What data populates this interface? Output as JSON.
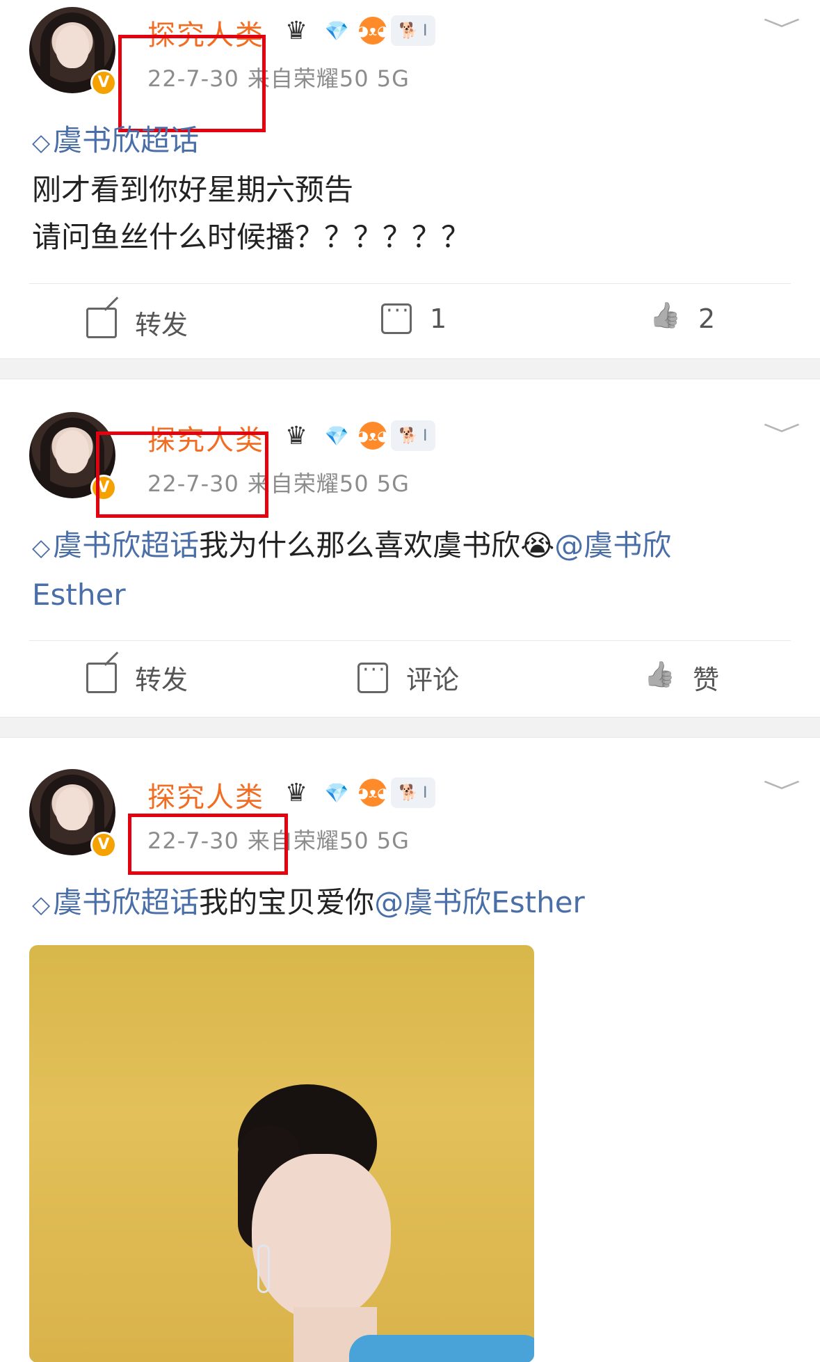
{
  "posts": [
    {
      "username": "探究人类",
      "date": "22-7-30",
      "source": "来自荣耀50 5G",
      "verified_badge": "V",
      "topic": "虞书欣超话",
      "text_lines": [
        "刚才看到你好星期六预告",
        "请问鱼丝什么时候播？？？？？？"
      ],
      "actions": {
        "repost": "转发",
        "comment": "1",
        "like": "2"
      }
    },
    {
      "username": "探究人类",
      "date": "22-7-30",
      "source": "来自荣耀50 5G",
      "verified_badge": "V",
      "topic": "虞书欣超话",
      "text": "我为什么那么喜欢虞书欣",
      "emoji": "😭",
      "mention_a": "@虞书欣",
      "mention_b": "Esther",
      "actions": {
        "repost": "转发",
        "comment": "评论",
        "like": "赞"
      }
    },
    {
      "username": "探究人类",
      "date": "22-7-30",
      "source": "来自荣耀50 5G",
      "verified_badge": "V",
      "topic": "虞书欣超话",
      "text": "我的宝贝爱你",
      "mention": "@虞书欣Esther"
    }
  ],
  "icons": {
    "crown": "♛",
    "gem": "💎",
    "fox": "◕ᴥ◕",
    "dog": "🐕 I",
    "topic": "◇",
    "chevron": "﹀"
  },
  "colors": {
    "username": "#f26d22",
    "link": "#4a6ea8",
    "highlight_box": "#e3000f"
  }
}
